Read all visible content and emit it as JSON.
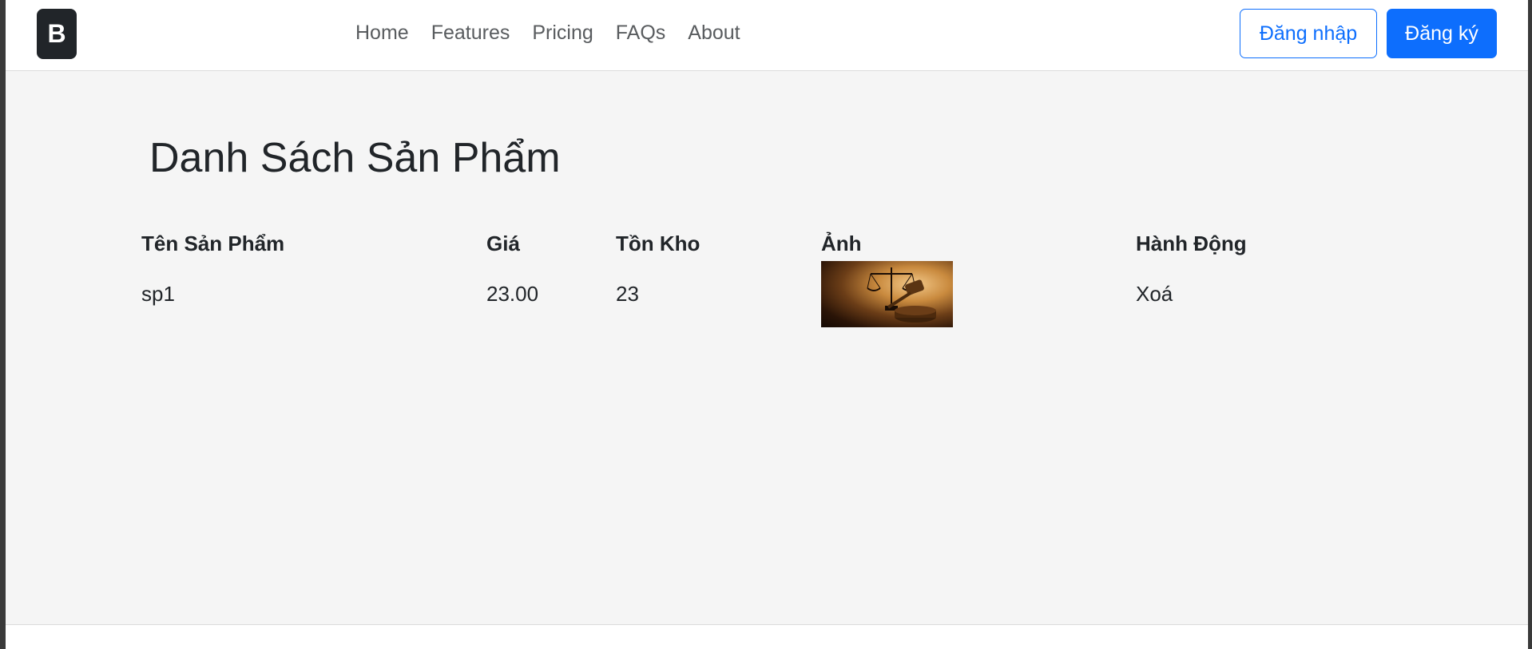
{
  "navbar": {
    "brand_letter": "B",
    "links": [
      "Home",
      "Features",
      "Pricing",
      "FAQs",
      "About"
    ],
    "login_label": "Đăng nhập",
    "signup_label": "Đăng ký"
  },
  "main": {
    "title": "Danh Sách Sản Phẩm",
    "table": {
      "headers": [
        "Tên Sản Phẩm",
        "Giá",
        "Tồn Kho",
        "Ảnh",
        "Hành Động"
      ],
      "rows": [
        {
          "name": "sp1",
          "price": "23.00",
          "stock": "23",
          "image_icon": "gavel-scales-photo",
          "action": "Xoá"
        }
      ]
    }
  }
}
